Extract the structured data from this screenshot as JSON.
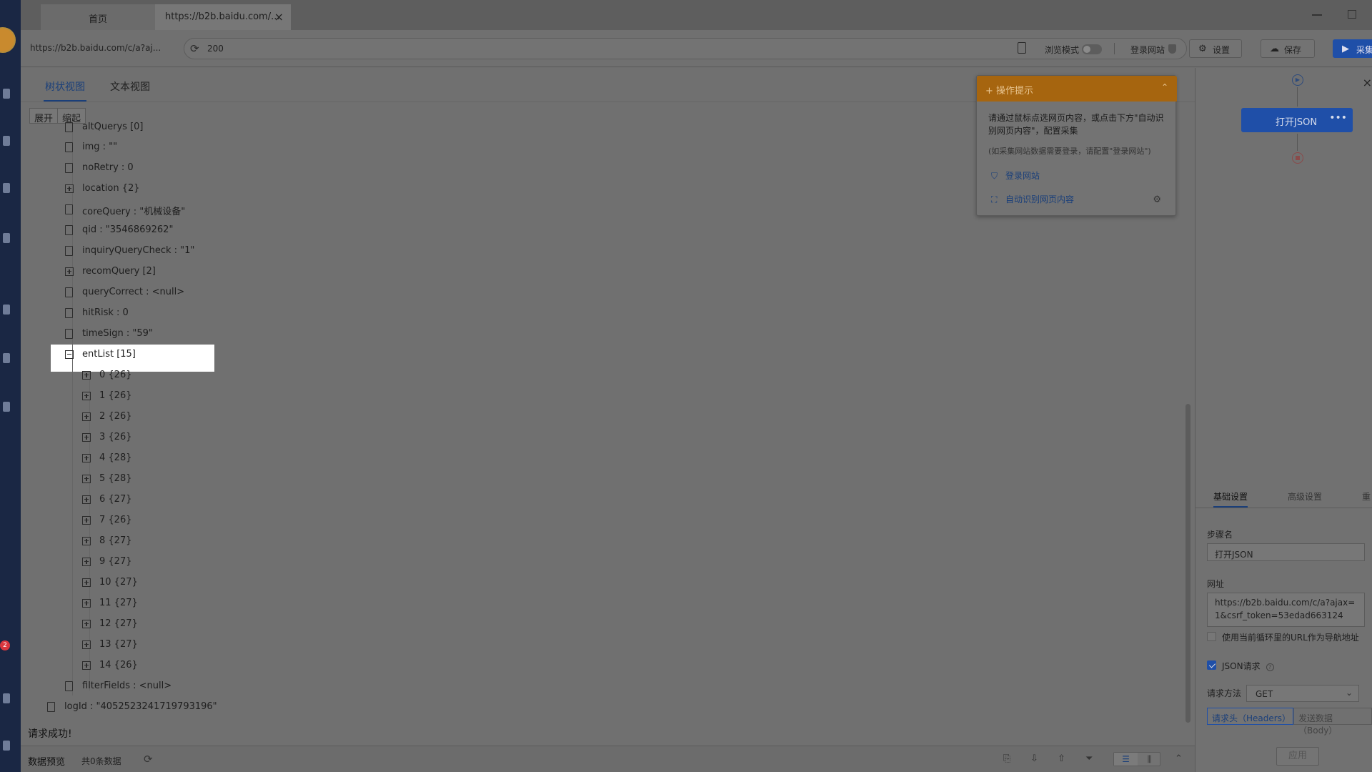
{
  "tabs": {
    "home": "首页",
    "active": "https://b2b.baidu.com/..."
  },
  "address": {
    "short_url": "https://b2b.baidu.com/c/a?aj...",
    "status": "200",
    "browse_mode": "浏览模式",
    "login_site": "登录网站"
  },
  "toolbar": {
    "settings": "设置",
    "save": "保存",
    "collect": "采集"
  },
  "view_tabs": {
    "tree": "树状视图",
    "text": "文本视图"
  },
  "tree_controls": {
    "expand": "展开",
    "collapse": "缩起"
  },
  "tree_nodes": {
    "altQuerys": "altQuerys [0]",
    "img": "img : \"\"",
    "noRetry": "noRetry : 0",
    "location": "location {2}",
    "coreQuery": "coreQuery : \"机械设备\"",
    "qid": "qid : \"3546869262\"",
    "inquiryQueryCheck": "inquiryQueryCheck : \"1\"",
    "recomQuery": "recomQuery [2]",
    "queryCorrect": "queryCorrect : <null>",
    "hitRisk": "hitRisk : 0",
    "timeSign": "timeSign : \"59\"",
    "entList": "entList [15]",
    "ent": [
      "0 {26}",
      "1 {26}",
      "2 {26}",
      "3 {26}",
      "4 {28}",
      "5 {28}",
      "6 {27}",
      "7 {26}",
      "8 {27}",
      "9 {27}",
      "10 {27}",
      "11 {27}",
      "12 {27}",
      "13 {27}",
      "14 {26}"
    ],
    "filterFields": "filterFields : <null>",
    "logId": "logId : \"4052523241719793196\""
  },
  "status_message": "请求成功!",
  "bottom_bar": {
    "title": "数据预览",
    "count": "共0条数据"
  },
  "tip": {
    "title": "操作提示",
    "body": "请通过鼠标点选网页内容，或点击下方\"自动识别网页内容\"，配置采集",
    "note": "(如采集网站数据需要登录，请配置\"登录网站\")",
    "link_login": "登录网站",
    "link_auto": "自动识别网页内容"
  },
  "rail": {
    "badge": "2"
  },
  "right_panel": {
    "flow_node": "打开JSON",
    "tabs": {
      "basic": "基础设置",
      "advanced": "高级设置",
      "more": "重"
    },
    "step_name_label": "步骤名",
    "step_name_value": "打开JSON",
    "url_label": "网址",
    "url_value": "https://b2b.baidu.com/c/a?ajax=1&csrf_token=53edad663124",
    "use_loop_url": "使用当前循环里的URL作为导航地址",
    "json_request": "JSON请求",
    "method_label": "请求方法",
    "method_value": "GET",
    "headers_tab": "请求头（Headers）",
    "body_tab": "发送数据（Body）",
    "apply": "应用"
  }
}
